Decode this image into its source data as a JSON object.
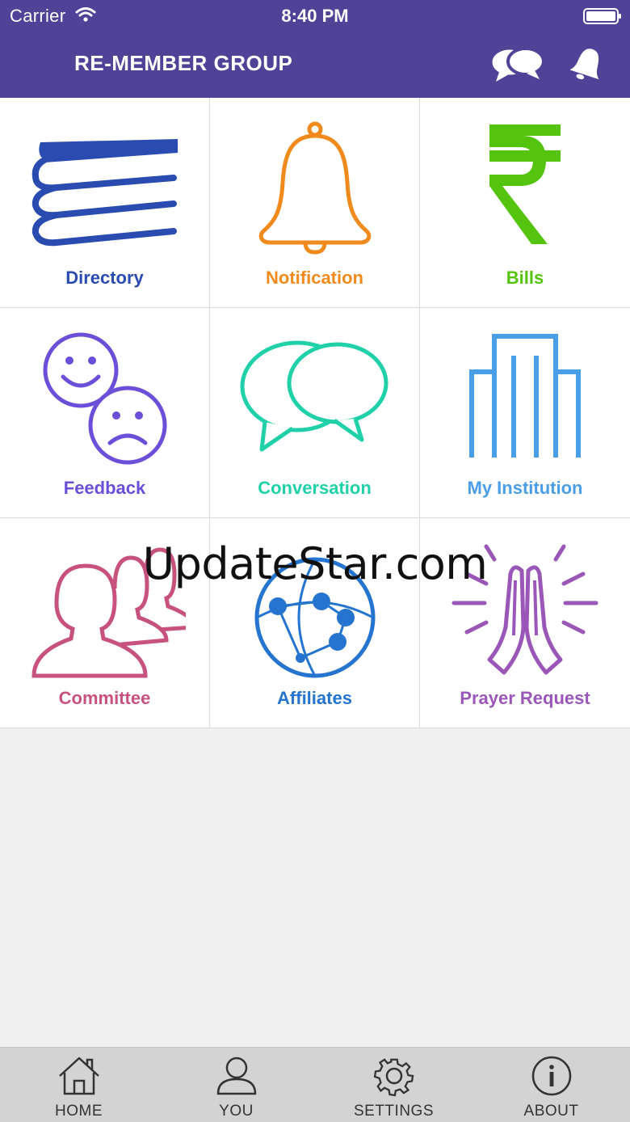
{
  "status": {
    "carrier": "Carrier",
    "time": "8:40 PM"
  },
  "header": {
    "title": "RE-MEMBER GROUP",
    "actions": [
      "chat-bubbles-icon",
      "bell-icon"
    ],
    "background": "#4f4297"
  },
  "tiles": [
    {
      "label": "Directory",
      "icon": "books-icon",
      "color": "#2a4bb0"
    },
    {
      "label": "Notification",
      "icon": "bell-icon",
      "color": "#f08a1c"
    },
    {
      "label": "Bills",
      "icon": "rupee-icon",
      "color": "#55c40f"
    },
    {
      "label": "Feedback",
      "icon": "smiley-faces-icon",
      "color": "#6c4fd8"
    },
    {
      "label": "Conversation",
      "icon": "chat-bubbles-icon",
      "color": "#1fd0a8"
    },
    {
      "label": "My Institution",
      "icon": "building-icon",
      "color": "#4a9ee8"
    },
    {
      "label": "Committee",
      "icon": "people-icon",
      "color": "#c8527e"
    },
    {
      "label": "Affiliates",
      "icon": "globe-network-icon",
      "color": "#2474d0"
    },
    {
      "label": "Prayer Request",
      "icon": "praying-hands-icon",
      "color": "#9a57b8"
    }
  ],
  "watermark": "UpdateStar.com",
  "tabbar": [
    {
      "label": "HOME",
      "icon": "home-icon"
    },
    {
      "label": "YOU",
      "icon": "user-icon"
    },
    {
      "label": "SETTINGS",
      "icon": "gear-icon"
    },
    {
      "label": "ABOUT",
      "icon": "info-icon"
    }
  ]
}
